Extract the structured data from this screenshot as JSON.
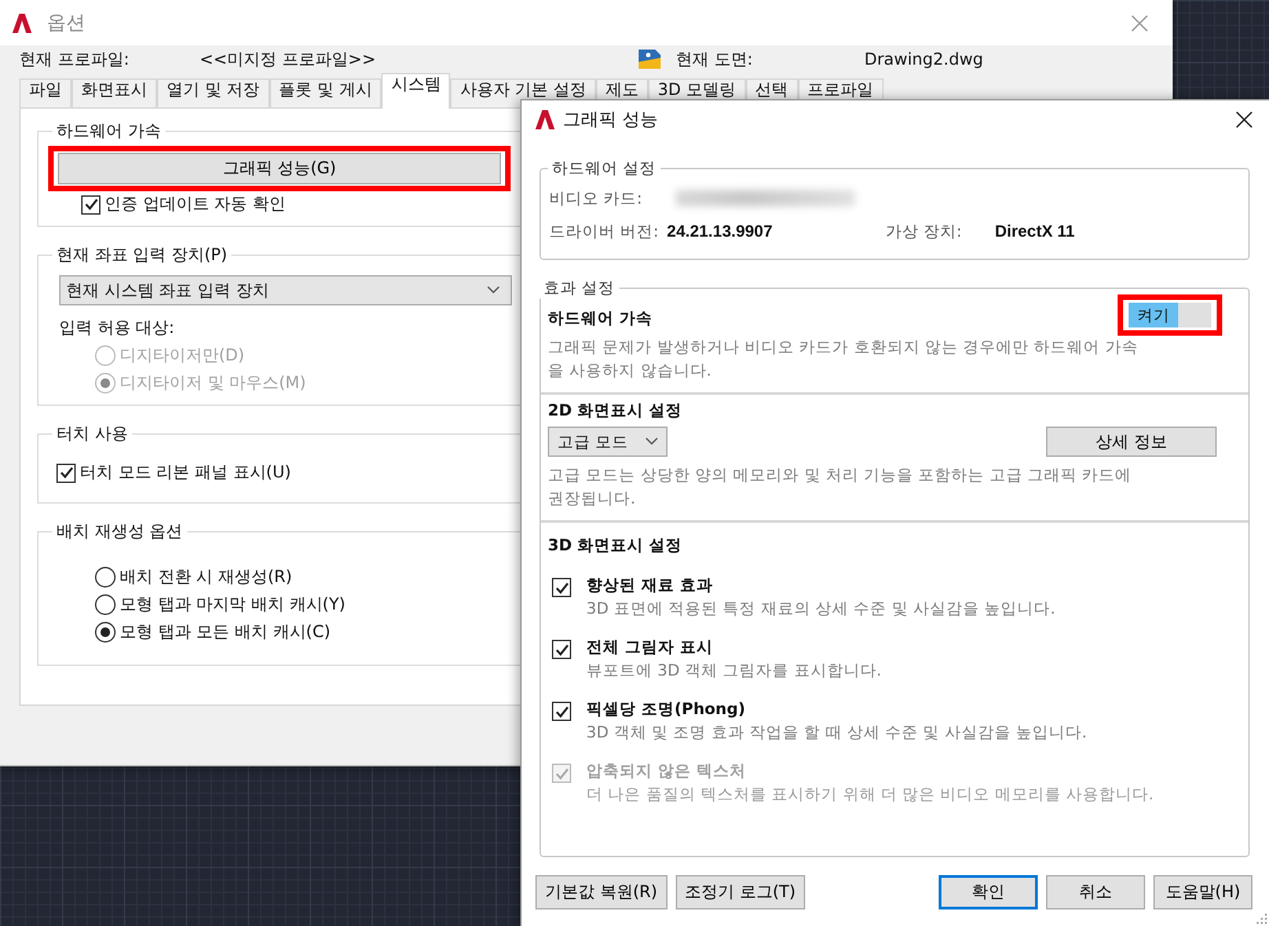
{
  "options_window": {
    "title": "옵션",
    "profile_label": "현재 프로파일:",
    "profile_value": "<<미지정 프로파일>>",
    "drawing_label": "현재 도면:",
    "drawing_value": "Drawing2.dwg",
    "tabs": [
      {
        "label": "파일",
        "selected": false
      },
      {
        "label": "화면표시",
        "selected": false
      },
      {
        "label": "열기 및 저장",
        "selected": false
      },
      {
        "label": "플롯 및 게시",
        "selected": false
      },
      {
        "label": "시스템",
        "selected": true
      },
      {
        "label": "사용자 기본 설정",
        "selected": false
      },
      {
        "label": "제도",
        "selected": false
      },
      {
        "label": "3D 모델링",
        "selected": false
      },
      {
        "label": "선택",
        "selected": false
      },
      {
        "label": "프로파일",
        "selected": false
      }
    ],
    "groups": [
      {
        "title": "하드웨어 가속",
        "items": [
          {
            "kind": "button",
            "label": "그래픽 성능(G)",
            "highlighted": true
          },
          {
            "kind": "checkbox",
            "label": "인증 업데이트 자동 확인",
            "checked": true,
            "disabled": false
          }
        ]
      },
      {
        "title": "현재 좌표 입력 장치(P)",
        "items": [
          {
            "kind": "dropdown",
            "value": "현재 시스템 좌표 입력 장치"
          },
          {
            "kind": "label",
            "text": "입력 허용 대상:"
          },
          {
            "kind": "radio",
            "label": "디지타이저만(D)",
            "selected": false,
            "disabled": true
          },
          {
            "kind": "radio",
            "label": "디지타이저 및 마우스(M)",
            "selected": true,
            "disabled": true
          }
        ]
      },
      {
        "title": "터치 사용",
        "items": [
          {
            "kind": "checkbox",
            "label": "터치 모드 리본 패널 표시(U)",
            "checked": true,
            "disabled": false
          }
        ]
      },
      {
        "title": "배치 재생성 옵션",
        "items": [
          {
            "kind": "radio",
            "label": "배치 전환 시 재생성(R)",
            "selected": false,
            "disabled": false
          },
          {
            "kind": "radio",
            "label": "모형 탭과 마지막 배치 캐시(Y)",
            "selected": false,
            "disabled": false
          },
          {
            "kind": "radio",
            "label": "모형 탭과 모든 배치 캐시(C)",
            "selected": true,
            "disabled": false
          }
        ]
      }
    ]
  },
  "graphics_dialog": {
    "title": "그래픽 성능",
    "hardware": {
      "title": "하드웨어 설정",
      "video_card_label": "비디오 카드:",
      "driver_label": "드라이버 버전:",
      "driver_value": "24.21.13.9907",
      "device_label": "가상 장치:",
      "device_value": "DirectX 11"
    },
    "effects": {
      "title": "효과 설정",
      "sections": [
        {
          "kind": "toggle",
          "title": "하드웨어 가속",
          "toggle": {
            "label": "켜기",
            "on": true,
            "highlighted": true
          },
          "description": "그래픽 문제가 발생하거나 비디오 카드가 호환되지 않는 경우에만 하드웨어 가속을 사용하지 않습니다."
        },
        {
          "kind": "mode",
          "title": "2D 화면표시 설정",
          "dropdown": "고급 모드",
          "button": "상세 정보",
          "description": "고급 모드는 상당한 양의 메모리와 및 처리 기능을 포함하는 고급 그래픽 카드에 권장됩니다."
        },
        {
          "kind": "checklist",
          "title": "3D 화면표시 설정",
          "items": [
            {
              "label": "향상된 재료 효과",
              "description": "3D 표면에 적용된 특정 재료의 상세 수준 및 사실감을 높입니다.",
              "checked": true,
              "disabled": false
            },
            {
              "label": "전체 그림자 표시",
              "description": "뷰포트에 3D 객체 그림자를 표시합니다.",
              "checked": true,
              "disabled": false
            },
            {
              "label": "픽셀당 조명(Phong)",
              "description": "3D 객체 및 조명 효과 작업을 할 때 상세 수준 및 사실감을 높입니다.",
              "checked": true,
              "disabled": false
            },
            {
              "label": "압축되지 않은 텍스처",
              "description": "더 나은 품질의 텍스처를 표시하기 위해 더 많은 비디오 메모리를 사용합니다.",
              "checked": true,
              "disabled": true
            }
          ]
        }
      ]
    },
    "buttons_left": [
      {
        "label": "기본값 복원(R)",
        "default": false
      },
      {
        "label": "조정기 로그(T)",
        "default": false
      }
    ],
    "buttons_right": [
      {
        "label": "확인",
        "default": true
      },
      {
        "label": "취소",
        "default": false
      },
      {
        "label": "도움말(H)",
        "default": false
      }
    ]
  }
}
